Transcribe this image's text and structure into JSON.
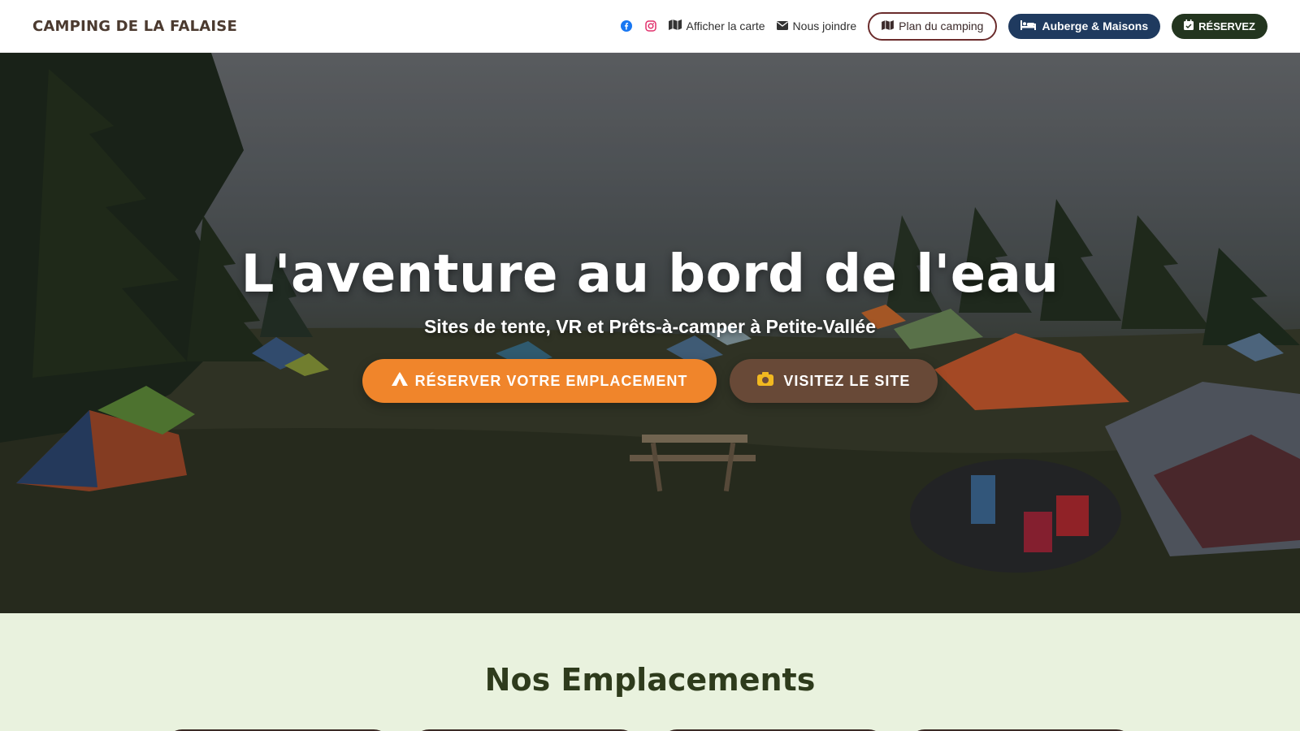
{
  "header": {
    "brand": "CAMPING DE LA FALAISE",
    "nav": {
      "facebook_icon": "facebook-icon",
      "instagram_icon": "instagram-icon",
      "map_label": "Afficher la carte",
      "contact_label": "Nous joindre",
      "plan_label": "Plan du camping",
      "auberge_label": "Auberge & Maisons",
      "reserve_label": "RÉSERVEZ"
    }
  },
  "hero": {
    "title": "L'aventure au bord de l'eau",
    "subtitle": "Sites de tente, VR et Prêts-à-camper à Petite-Vallée",
    "cta_primary": "RÉSERVER VOTRE EMPLACEMENT",
    "cta_secondary": "VISITEZ LE SITE"
  },
  "section": {
    "title": "Nos Emplacements"
  },
  "colors": {
    "brand_brown": "#4b3a2f",
    "orange": "#f0852b",
    "navy": "#1f3a5f",
    "dark_green": "#23351f",
    "section_bg": "#e9f2de"
  }
}
